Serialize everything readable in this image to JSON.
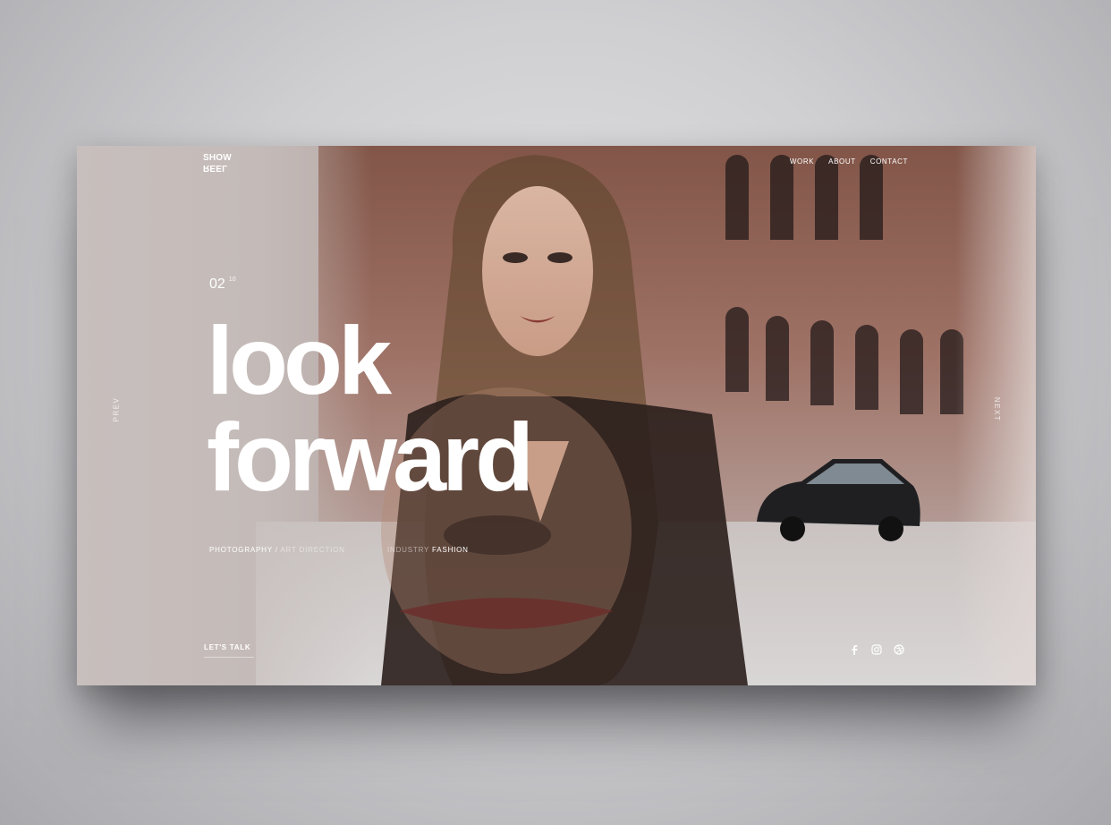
{
  "brand": {
    "line1": "SHOW",
    "line2": "REEL"
  },
  "nav": {
    "items": [
      "WORK",
      "ABOUT",
      "CONTACT"
    ]
  },
  "slide": {
    "index": "02",
    "total": "10"
  },
  "headline": {
    "line1": "look",
    "line2": "forward"
  },
  "meta": {
    "category_active": "PHOTOGRAPHY",
    "separator": "/",
    "category_other": "ART DIRECTION",
    "industry_label": "INDUSTRY",
    "industry_value": "FASHION"
  },
  "controls": {
    "prev": "PREV",
    "next": "NEXT"
  },
  "footer": {
    "cta": "LET'S TALK"
  },
  "social": {
    "icons": [
      "facebook-icon",
      "instagram-icon",
      "dribbble-icon"
    ]
  },
  "colors": {
    "text": "#ffffff",
    "page_bg": "#cfcfd2",
    "card_tint": "#b9aca8"
  }
}
